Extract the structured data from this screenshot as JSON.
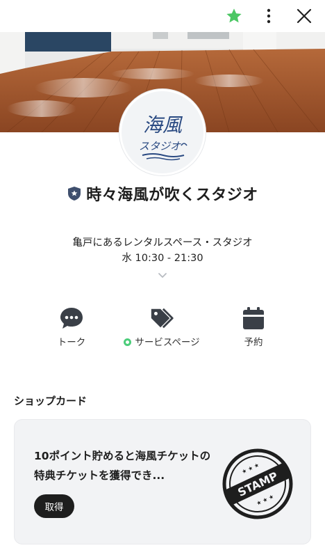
{
  "topbar": {
    "favorite_icon": "star-icon",
    "more_icon": "more-vertical-icon",
    "close_icon": "close-icon",
    "accent": "#4cc764"
  },
  "profile": {
    "logo_line1": "海風",
    "logo_line2": "スタジオ",
    "badge_icon": "certified-shield-icon",
    "name": "時々海風が吹くスタジオ",
    "description": "亀戸にあるレンタルスペース・スタジオ",
    "hours": "水 10:30 - 21:30"
  },
  "actions": {
    "talk": {
      "label": "トーク",
      "icon": "chat-bubble-icon"
    },
    "service": {
      "label": "サービスページ",
      "icon": "tags-icon"
    },
    "reserve": {
      "label": "予約",
      "icon": "calendar-icon"
    }
  },
  "shopcard": {
    "section_title": "ショップカード",
    "text": "10ポイント貯めると海風チケットの特典チケットを獲得でき...",
    "button_label": "取得",
    "stamp_text": "STAMP"
  }
}
